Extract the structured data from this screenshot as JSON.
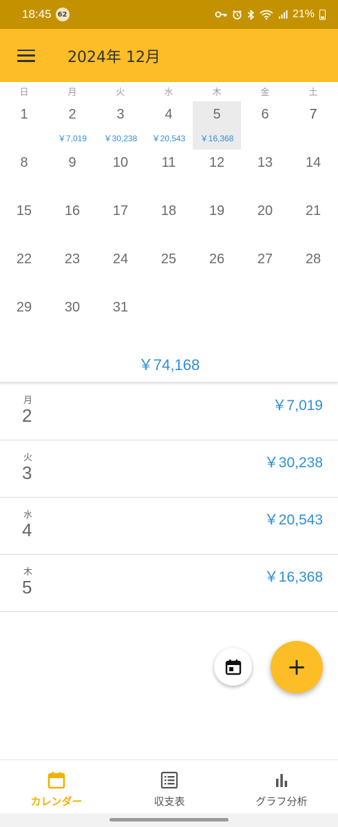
{
  "status_bar": {
    "time": "18:45",
    "notification_count": "62",
    "battery": "21%"
  },
  "app_bar": {
    "title": "2024年 12月"
  },
  "calendar": {
    "weekdays": [
      "日",
      "月",
      "火",
      "水",
      "木",
      "金",
      "土"
    ],
    "weeks": [
      [
        {
          "day": "1",
          "amount": ""
        },
        {
          "day": "2",
          "amount": "￥7,019"
        },
        {
          "day": "3",
          "amount": "￥30,238"
        },
        {
          "day": "4",
          "amount": "￥20,543"
        },
        {
          "day": "5",
          "amount": "￥16,368"
        },
        {
          "day": "6",
          "amount": ""
        },
        {
          "day": "7",
          "amount": ""
        }
      ],
      [
        {
          "day": "8"
        },
        {
          "day": "9"
        },
        {
          "day": "10"
        },
        {
          "day": "11"
        },
        {
          "day": "12"
        },
        {
          "day": "13"
        },
        {
          "day": "14"
        }
      ],
      [
        {
          "day": "15"
        },
        {
          "day": "16"
        },
        {
          "day": "17"
        },
        {
          "day": "18"
        },
        {
          "day": "19"
        },
        {
          "day": "20"
        },
        {
          "day": "21"
        }
      ],
      [
        {
          "day": "22"
        },
        {
          "day": "23"
        },
        {
          "day": "24"
        },
        {
          "day": "25"
        },
        {
          "day": "26"
        },
        {
          "day": "27"
        },
        {
          "day": "28"
        }
      ],
      [
        {
          "day": "29"
        },
        {
          "day": "30"
        },
        {
          "day": "31"
        }
      ]
    ],
    "selected_day": "5",
    "month_total": "￥74,168"
  },
  "entries": [
    {
      "weekday": "月",
      "day": "2",
      "amount": "￥7,019"
    },
    {
      "weekday": "火",
      "day": "3",
      "amount": "￥30,238"
    },
    {
      "weekday": "水",
      "day": "4",
      "amount": "￥20,543"
    },
    {
      "weekday": "木",
      "day": "5",
      "amount": "￥16,368"
    }
  ],
  "bottom_nav": {
    "items": [
      {
        "label": "カレンダー",
        "icon": "calendar-icon",
        "active": true
      },
      {
        "label": "収支表",
        "icon": "list-icon",
        "active": false
      },
      {
        "label": "グラフ分析",
        "icon": "bar-chart-icon",
        "active": false
      }
    ]
  },
  "colors": {
    "accent": "#fcbd27",
    "status_bar": "#c49200",
    "amount_blue": "#2e8fd6",
    "nav_active": "#f4b000"
  }
}
